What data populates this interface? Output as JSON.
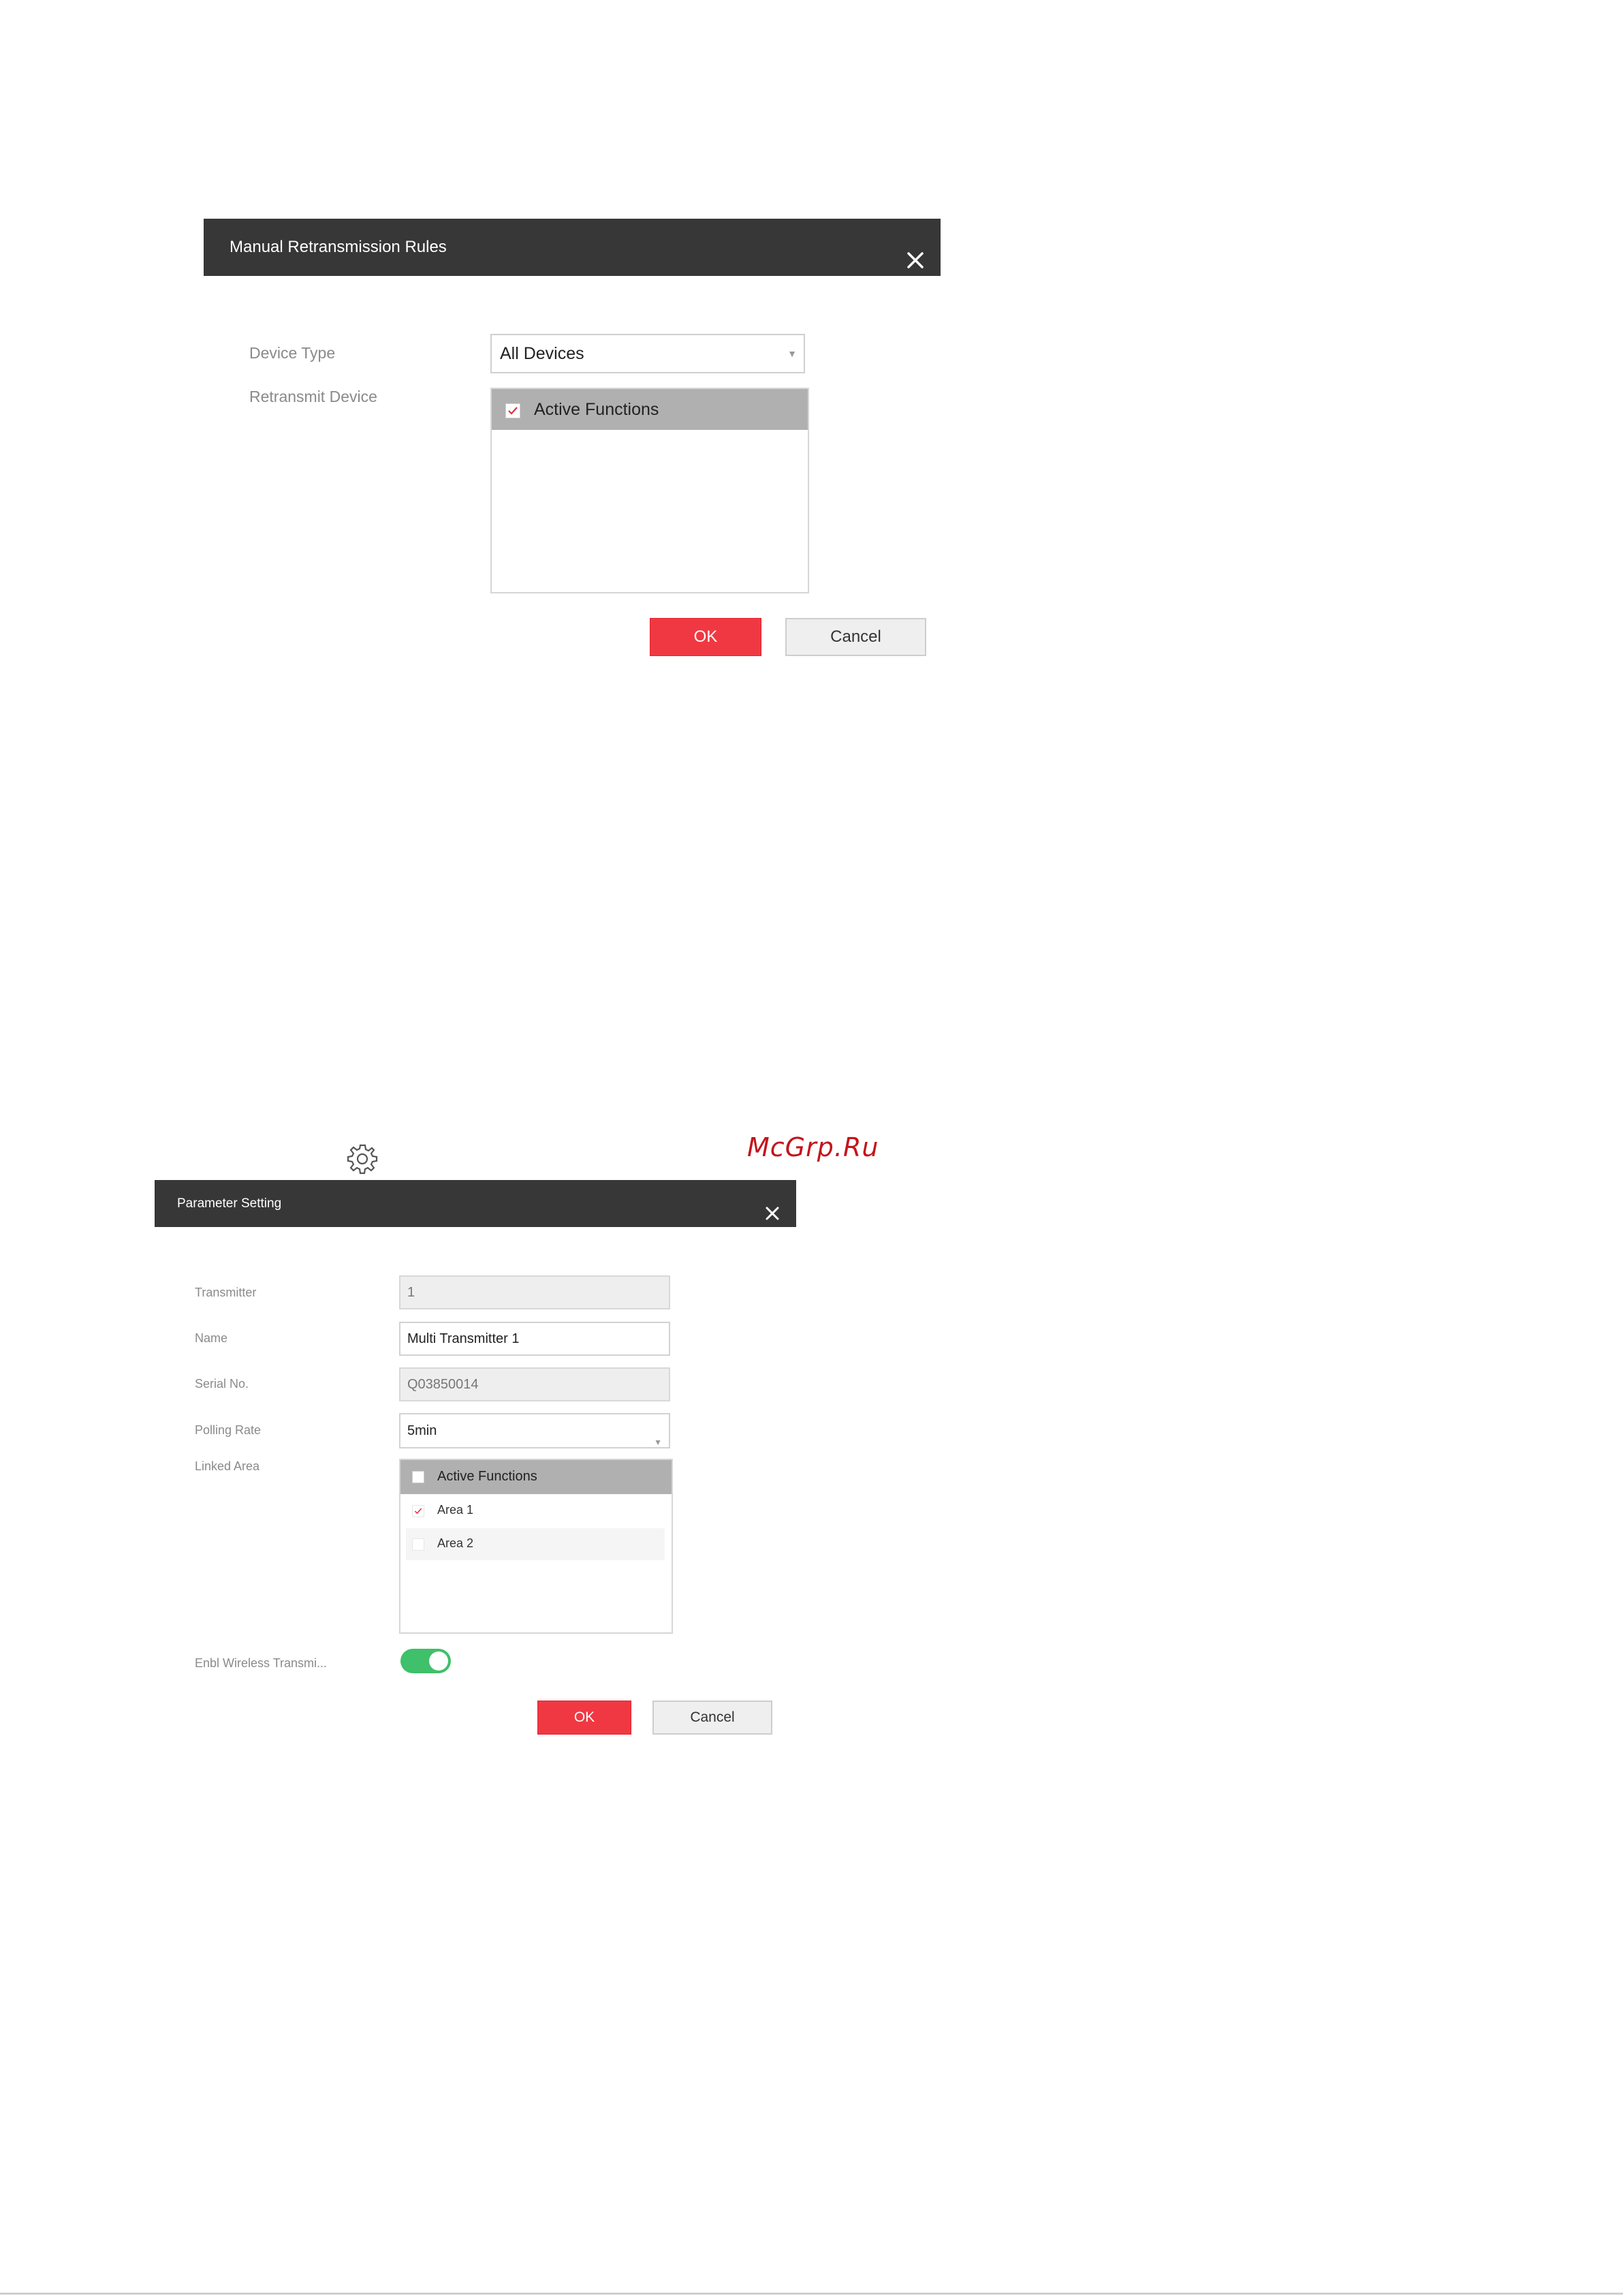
{
  "dialog1": {
    "title": "Manual Retransmission Rules",
    "device_type_label": "Device Type",
    "device_type_value": "All Devices",
    "retransmit_device_label": "Retransmit Device",
    "list_header": "Active Functions",
    "list_header_checked": true,
    "ok_label": "OK",
    "cancel_label": "Cancel"
  },
  "watermark": "McGrp.Ru",
  "gear_icon": "gear-icon",
  "dialog2": {
    "title": "Parameter Setting",
    "transmitter_label": "Transmitter",
    "transmitter_value": "1",
    "name_label": "Name",
    "name_value": "Multi Transmitter 1",
    "serial_label": "Serial No.",
    "serial_value": "Q03850014",
    "polling_label": "Polling Rate",
    "polling_value": "5min",
    "linked_area_label": "Linked Area",
    "list_header": "Active Functions",
    "areas": [
      {
        "label": "Area 1",
        "checked": true
      },
      {
        "label": "Area 2",
        "checked": false
      }
    ],
    "enable_label": "Enbl Wireless Transmi...",
    "enable_on": true,
    "ok_label": "OK",
    "cancel_label": "Cancel"
  },
  "colors": {
    "header": "#373737",
    "ok_red": "#f03843",
    "toggle_green": "#3fc06a",
    "watermark": "#c3151c"
  }
}
